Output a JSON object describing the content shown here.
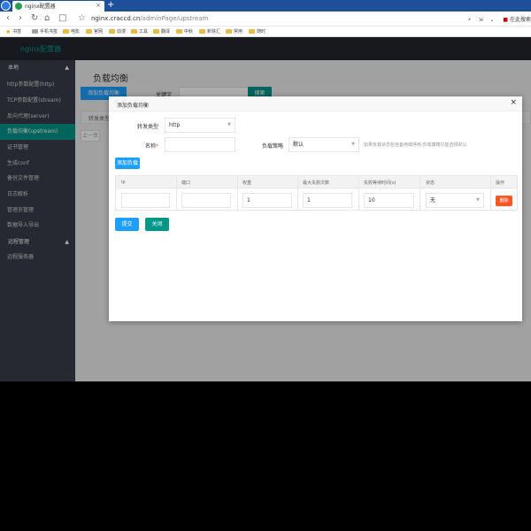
{
  "browser": {
    "tab_title": "nginx配置器",
    "tab_close": "×",
    "new_tab": "+",
    "url_host": "nginx.craccd.cn",
    "url_path": "/adminPage/upstream",
    "right_text": "在此搜索",
    "bookmarks": [
      "书签",
      "手机书签",
      "电影",
      "官网",
      "动漫",
      "工具",
      "翻译",
      "中秋",
      "新铁汇",
      "常用",
      "随时"
    ]
  },
  "app": {
    "brand": "nginx配置器",
    "sidebar": {
      "group1": "本地",
      "items": [
        "http参数配置(http)",
        "TCP参数配置(stream)",
        "反向代理(server)",
        "负载均衡(upstream)",
        "证书管理",
        "生成conf",
        "备份文件管理",
        "日志解析",
        "管理员管理",
        "数据导入导出"
      ],
      "group2": "远程管理",
      "items2": [
        "远程服务器"
      ]
    },
    "page": {
      "title": "负载均衡",
      "add_button": "添加负载均衡",
      "keyword_label": "关键字",
      "search_button": "搜索",
      "table_header": "转发类型",
      "prev": "上一页"
    }
  },
  "modal": {
    "title": "添加负载均衡",
    "close": "×",
    "forward_type_label": "转发类型",
    "forward_type_value": "http",
    "name_label": "名称",
    "required_mark": "*",
    "strategy_label": "负载策略",
    "strategy_value": "默认",
    "strategy_hint": "如果负载状态包含备用或停用,负载策略只能选择默认",
    "add_load_button": "添加负载",
    "columns": [
      "ip",
      "端口",
      "权重",
      "最大失败次数",
      "失败等待时间(s)",
      "状态",
      "操作"
    ],
    "row": {
      "ip": "",
      "port": "",
      "weight": "1",
      "max_fails": "1",
      "fail_timeout": "10",
      "status": "无",
      "delete": "删除"
    },
    "submit_button": "提交",
    "close_button": "关闭"
  },
  "colors": {
    "accent_teal": "#009688",
    "accent_blue": "#1e9fff",
    "danger": "#ff5722",
    "sidebar_bg": "#393d49",
    "topbar_bg": "#23262e"
  }
}
